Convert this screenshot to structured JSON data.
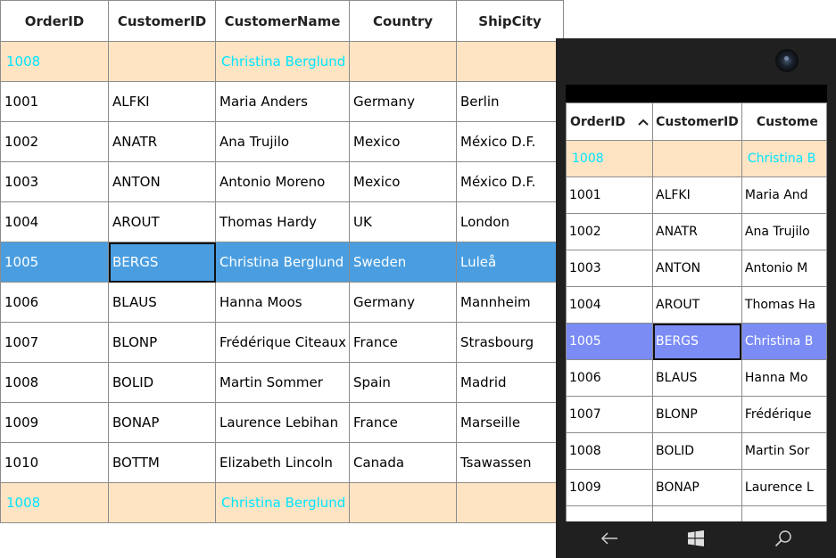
{
  "columns": [
    "OrderID",
    "CustomerID",
    "CustomerName",
    "Country",
    "ShipCity"
  ],
  "summary_top": {
    "order_id": "1008",
    "customer_name": "Christina Berglund"
  },
  "summary_bottom": {
    "order_id": "1008",
    "customer_name": "Christina Berglund"
  },
  "rows": [
    [
      "1001",
      "ALFKI",
      "Maria Anders",
      "Germany",
      "Berlin"
    ],
    [
      "1002",
      "ANATR",
      "Ana Trujilo",
      "Mexico",
      "México D.F."
    ],
    [
      "1003",
      "ANTON",
      "Antonio Moreno",
      "Mexico",
      "México D.F."
    ],
    [
      "1004",
      "AROUT",
      "Thomas Hardy",
      "UK",
      "London"
    ],
    [
      "1005",
      "BERGS",
      "Christina Berglund",
      "Sweden",
      "Luleå"
    ],
    [
      "1006",
      "BLAUS",
      "Hanna Moos",
      "Germany",
      "Mannheim"
    ],
    [
      "1007",
      "BLONP",
      "Frédérique Citeaux",
      "France",
      "Strasbourg"
    ],
    [
      "1008",
      "BOLID",
      "Martin Sommer",
      "Spain",
      "Madrid"
    ],
    [
      "1009",
      "BONAP",
      "Laurence Lebihan",
      "France",
      "Marseille"
    ],
    [
      "1010",
      "BOTTM",
      "Elizabeth Lincoln",
      "Canada",
      "Tsawassen"
    ]
  ],
  "selected_row_index": 4,
  "phone": {
    "columns": [
      "OrderID",
      "CustomerID",
      "Custome"
    ],
    "summary_top": {
      "order_id": "1008",
      "customer_name": "Christina B"
    },
    "rows": [
      [
        "1001",
        "ALFKI",
        "Maria And"
      ],
      [
        "1002",
        "ANATR",
        "Ana Trujilo"
      ],
      [
        "1003",
        "ANTON",
        "Antonio M"
      ],
      [
        "1004",
        "AROUT",
        "Thomas Ha"
      ],
      [
        "1005",
        "BERGS",
        "Christina B"
      ],
      [
        "1006",
        "BLAUS",
        "Hanna Mo"
      ],
      [
        "1007",
        "BLONP",
        "Frédérique"
      ],
      [
        "1008",
        "BOLID",
        "Martin Sor"
      ],
      [
        "1009",
        "BONAP",
        "Laurence L"
      ]
    ],
    "nav_icons": [
      "back-icon",
      "windows-icon",
      "search-icon"
    ]
  },
  "colors": {
    "summary_bg": "#ffe4c4",
    "summary_text": "#00e5ff",
    "selected_desktop": "#4a9ee0",
    "selected_phone": "#7b8cf5",
    "phone_frame": "#202020"
  }
}
